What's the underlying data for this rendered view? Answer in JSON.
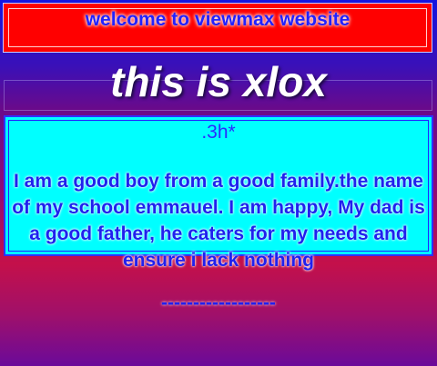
{
  "banner": {
    "text": "welcome to viewmax website"
  },
  "title": "this is xlox",
  "panel": {
    "subtitle": ".3h*",
    "paragraph": "I am a good boy from a good family.the name of my school emmauel. I am happy, My dad is a good father, he caters for my needs and ensure i lack nothing"
  },
  "divider": "------------------",
  "colors": {
    "banner_bg": "#ff0000",
    "panel_bg": "#00ffff",
    "text_blue": "#2020ee",
    "title_white": "#ffffff"
  }
}
